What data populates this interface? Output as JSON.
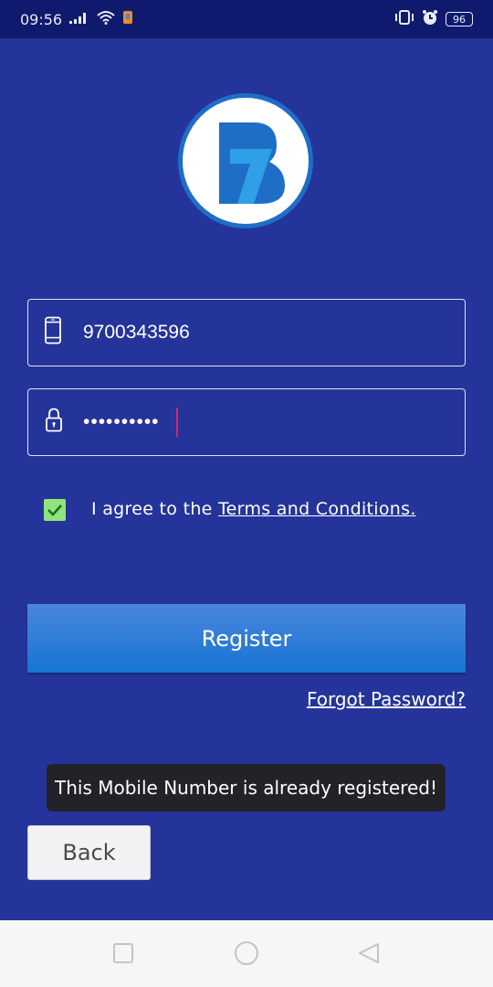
{
  "status_bar": {
    "time": "09:56",
    "battery": "96",
    "icons": [
      "signal-icon",
      "wifi-icon",
      "app-notification-icon",
      "vibrate-icon",
      "alarm-icon",
      "battery-icon"
    ]
  },
  "logo": {
    "name": "app-logo"
  },
  "phone_field": {
    "value": "9700343596",
    "icon": "mobile-phone-icon"
  },
  "password_field": {
    "value": "••••••••••",
    "icon": "lock-icon"
  },
  "agreement": {
    "checked": true,
    "text": "I agree to the ",
    "link_text": "Terms and Conditions."
  },
  "register_button": {
    "label": "Register"
  },
  "forgot_link": {
    "label": "Forgot Password?"
  },
  "toast": {
    "message": "This Mobile Number is already registered!"
  },
  "back_button": {
    "label": "Back"
  },
  "nav_bar": {
    "icons": [
      "recents-icon",
      "home-icon",
      "back-nav-icon"
    ]
  },
  "colors": {
    "background": "#25349a",
    "status_bar": "#0f1a6e",
    "register_button": "#1674d2",
    "checkbox": "#8fe47a",
    "caret": "#e0245e",
    "toast": "#232229"
  }
}
